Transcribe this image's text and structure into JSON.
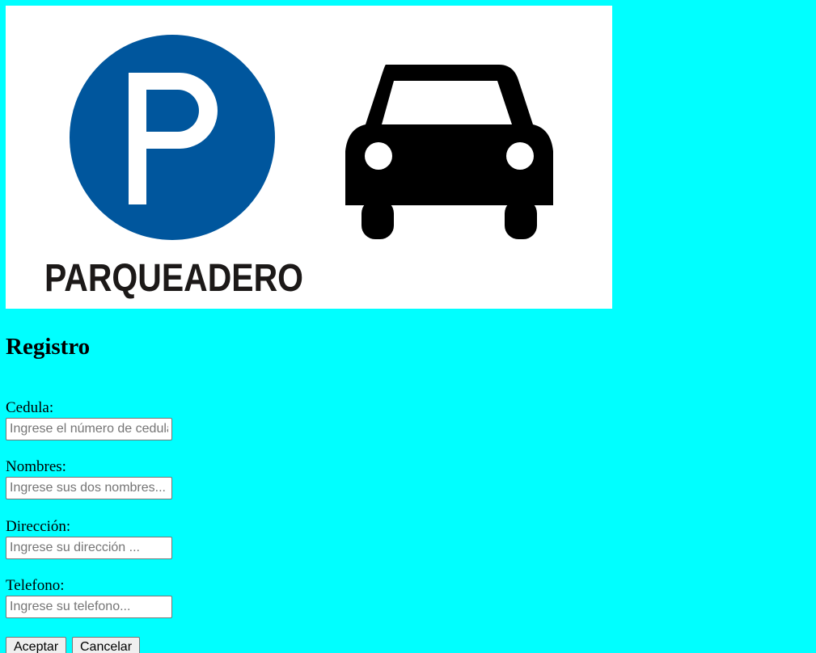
{
  "banner": {
    "logo_text": "PARQUEADERO",
    "parking_letter": "P",
    "colors": {
      "parking_circle": "#00569d",
      "background": "#ffffff",
      "car": "#000000",
      "text": "#1c1918"
    },
    "icons": [
      "parking-sign-icon",
      "car-icon"
    ]
  },
  "page": {
    "title": "Registro",
    "background": "#00ffff"
  },
  "form": {
    "fields": [
      {
        "label": "Cedula:",
        "placeholder": "Ingrese el número de cedula..."
      },
      {
        "label": "Nombres:",
        "placeholder": "Ingrese sus dos nombres..."
      },
      {
        "label": "Dirección:",
        "placeholder": "Ingrese su dirección ..."
      },
      {
        "label": "Telefono:",
        "placeholder": "Ingrese su telefono..."
      }
    ],
    "submit_label": "Aceptar",
    "cancel_label": "Cancelar"
  }
}
